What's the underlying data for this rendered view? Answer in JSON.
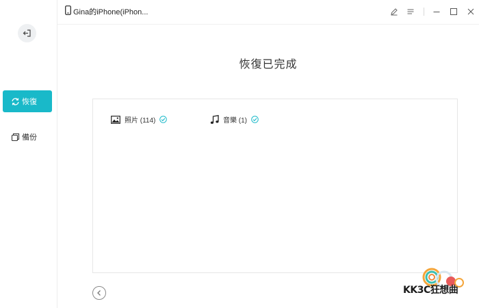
{
  "window": {
    "device_name": "Gina的iPhone(iPhon..."
  },
  "sidebar": {
    "items": [
      {
        "label": "恢復",
        "icon": "refresh-icon",
        "active": true
      },
      {
        "label": "備份",
        "icon": "backup-icon",
        "active": false
      }
    ]
  },
  "main": {
    "title": "恢復已完成",
    "results": [
      {
        "label": "照片 (114)",
        "icon": "image-icon",
        "status": "check-circle-icon"
      },
      {
        "label": "音樂 (1)",
        "icon": "music-note-icon",
        "status": "check-circle-icon"
      }
    ]
  },
  "watermark": {
    "text": "KK3C狂想曲"
  },
  "colors": {
    "accent": "#19b9c9",
    "check": "#19b9c9",
    "border": "#e6e6e6"
  }
}
